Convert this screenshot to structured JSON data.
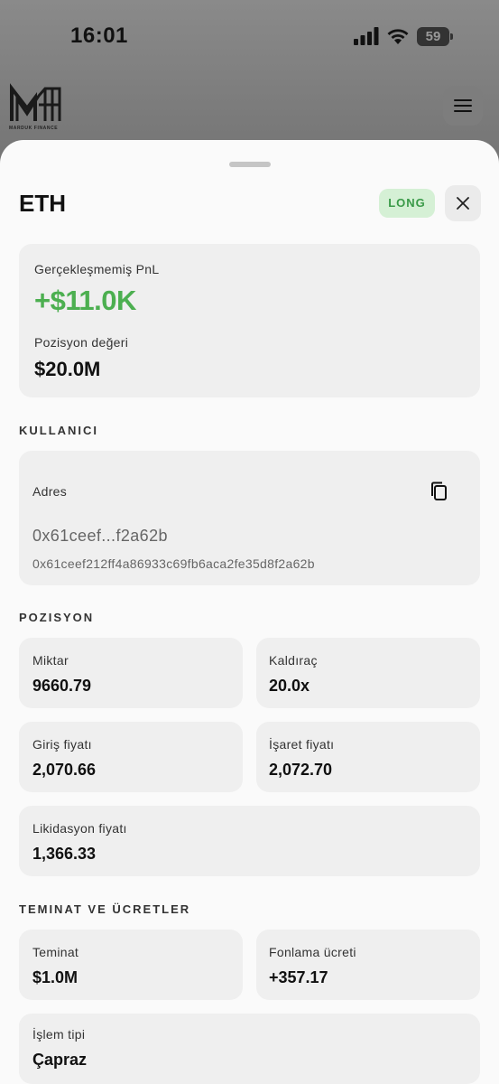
{
  "status_bar": {
    "time": "16:01",
    "battery": "59"
  },
  "header": {
    "brand_text": "MARDUK FINANCE"
  },
  "sheet": {
    "asset": "ETH",
    "side_badge": "LONG",
    "summary": {
      "unrealized_pnl_label": "Gerçekleşmemiş PnL",
      "unrealized_pnl_value": "+$11.0K",
      "position_value_label": "Pozisyon değeri",
      "position_value": "$20.0M"
    },
    "user_section": {
      "title": "KULLANICI",
      "address_label": "Adres",
      "address_short": "0x61ceef...f2a62b",
      "address_full": "0x61ceef212ff4a86933c69fb6aca2fe35d8f2a62b"
    },
    "position_section": {
      "title": "POZISYON",
      "quantity_label": "Miktar",
      "quantity_value": "9660.79",
      "leverage_label": "Kaldıraç",
      "leverage_value": "20.0x",
      "entry_label": "Giriş fiyatı",
      "entry_value": "2,070.66",
      "mark_label": "İşaret fiyatı",
      "mark_value": "2,072.70",
      "liq_label": "Likidasyon fiyatı",
      "liq_value": "1,366.33"
    },
    "collateral_section": {
      "title": "TEMINAT VE ÜCRETLER",
      "collateral_label": "Teminat",
      "collateral_value": "$1.0M",
      "funding_label": "Fonlama ücreti",
      "funding_value": "+357.17",
      "margin_type_label": "İşlem tipi",
      "margin_type_value": "Çapraz"
    }
  },
  "colors": {
    "profit": "#4caf50",
    "long_badge_bg": "#d5f0d5",
    "long_badge_text": "#3a9a48"
  },
  "icons": [
    "signal-icon",
    "wifi-icon",
    "battery-icon",
    "menu-icon",
    "close-icon",
    "copy-icon"
  ]
}
